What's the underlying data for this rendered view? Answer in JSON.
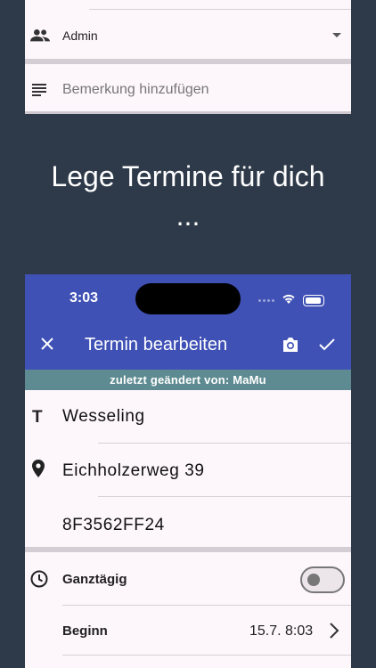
{
  "top_card": {
    "admin_label": "Admin",
    "note_placeholder": "Bemerkung hinzufügen"
  },
  "headline": {
    "line1": "Lege Termine für dich",
    "line2": "..."
  },
  "phone": {
    "status_time": "3:03",
    "appbar_title": "Termin bearbeiten",
    "changed_by": "zuletzt geändert von: MaMu",
    "title_value": "Wesseling",
    "title_icon_glyph": "T",
    "location_value": "Eichholzerweg 39",
    "code_value": "8F3562FF24",
    "allday_label": "Ganztägig",
    "allday_on": false,
    "begin_label": "Beginn",
    "begin_value": "15.7. 8:03"
  },
  "colors": {
    "background": "#2e3a4a",
    "appbar": "#3f51b5",
    "changed_bar": "#5e8b91",
    "card": "#fdf6fb"
  },
  "icons": [
    "group-icon",
    "caret-down-icon",
    "notes-icon",
    "wifi-icon",
    "battery-icon",
    "close-icon",
    "camera-icon",
    "check-icon",
    "title-icon",
    "location-pin-icon",
    "clock-icon",
    "chevron-right-icon"
  ]
}
